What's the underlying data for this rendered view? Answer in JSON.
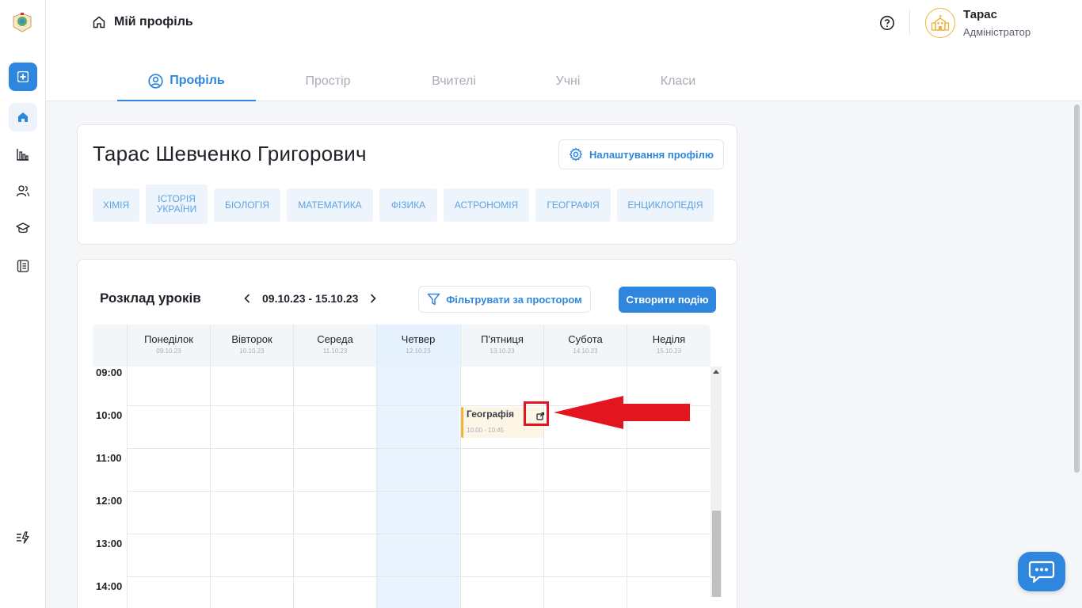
{
  "header": {
    "page_title": "Мій профіль",
    "user": {
      "name": "Тарас",
      "role": "Адміністратор"
    }
  },
  "tabs": [
    {
      "label": "Профіль",
      "active": true
    },
    {
      "label": "Простір",
      "active": false
    },
    {
      "label": "Вчителі",
      "active": false
    },
    {
      "label": "Учні",
      "active": false
    },
    {
      "label": "Класи",
      "active": false
    }
  ],
  "profile": {
    "full_name": "Тарас Шевченко Григорович",
    "settings_label": "Налаштування профілю",
    "subjects": [
      "Хімія",
      "Історія України",
      "Біологія",
      "Математика",
      "Фізика",
      "Астрономія",
      "Географія",
      "Енциклопедія"
    ]
  },
  "schedule": {
    "title": "Розклад уроків",
    "week_range": "09.10.23 - 15.10.23",
    "filter_label": "Фільтрувати за простором",
    "create_label": "Створити подію",
    "days": [
      {
        "name": "Понеділок",
        "date": "09.10.23",
        "today": false
      },
      {
        "name": "Вівторок",
        "date": "10.10.23",
        "today": false
      },
      {
        "name": "Середа",
        "date": "11.10.23",
        "today": false
      },
      {
        "name": "Четвер",
        "date": "12.10.23",
        "today": true
      },
      {
        "name": "П'ятниця",
        "date": "13.10.23",
        "today": false
      },
      {
        "name": "Субота",
        "date": "14.10.23",
        "today": false
      },
      {
        "name": "Неділя",
        "date": "15.10.23",
        "today": false
      }
    ],
    "times": [
      "09:00",
      "10:00",
      "11:00",
      "12:00",
      "13:00",
      "14:00"
    ],
    "event": {
      "title": "Географія",
      "time": "10:00 - 10:45",
      "day": "П'ятниця"
    }
  },
  "colors": {
    "accent": "#2f86de",
    "event_border": "#f2b13a",
    "today_column": "#e8f3fd",
    "annotation": "#e3161f"
  }
}
